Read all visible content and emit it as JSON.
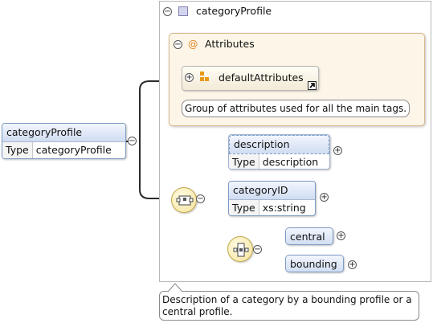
{
  "root": {
    "name": "categoryProfile",
    "type_key": "Type",
    "type_value": "categoryProfile"
  },
  "complex": {
    "title": "categoryProfile",
    "toggle": "⊖"
  },
  "attributes": {
    "title": "Attributes",
    "symbol": "@",
    "group_name": "defaultAttributes",
    "group_note": "Group of attributes used for all the main tags."
  },
  "children": [
    {
      "name": "description",
      "type_key": "Type",
      "type_value": "description"
    },
    {
      "name": "categoryID",
      "type_key": "Type",
      "type_value": "xs:string"
    }
  ],
  "choice": [
    {
      "name": "central"
    },
    {
      "name": "bounding"
    }
  ],
  "description_note": "Description of a category by a bounding profile or a central profile.",
  "icons": {
    "collapse": "minus-circle",
    "expand": "plus-circle",
    "sequence": "sequence-icon",
    "choice": "choice-icon"
  },
  "colors": {
    "element_header": "#cfdcf2",
    "attributes_bg": "#fdf5e8",
    "compositor": "#f5e39c",
    "line": "#222222"
  }
}
